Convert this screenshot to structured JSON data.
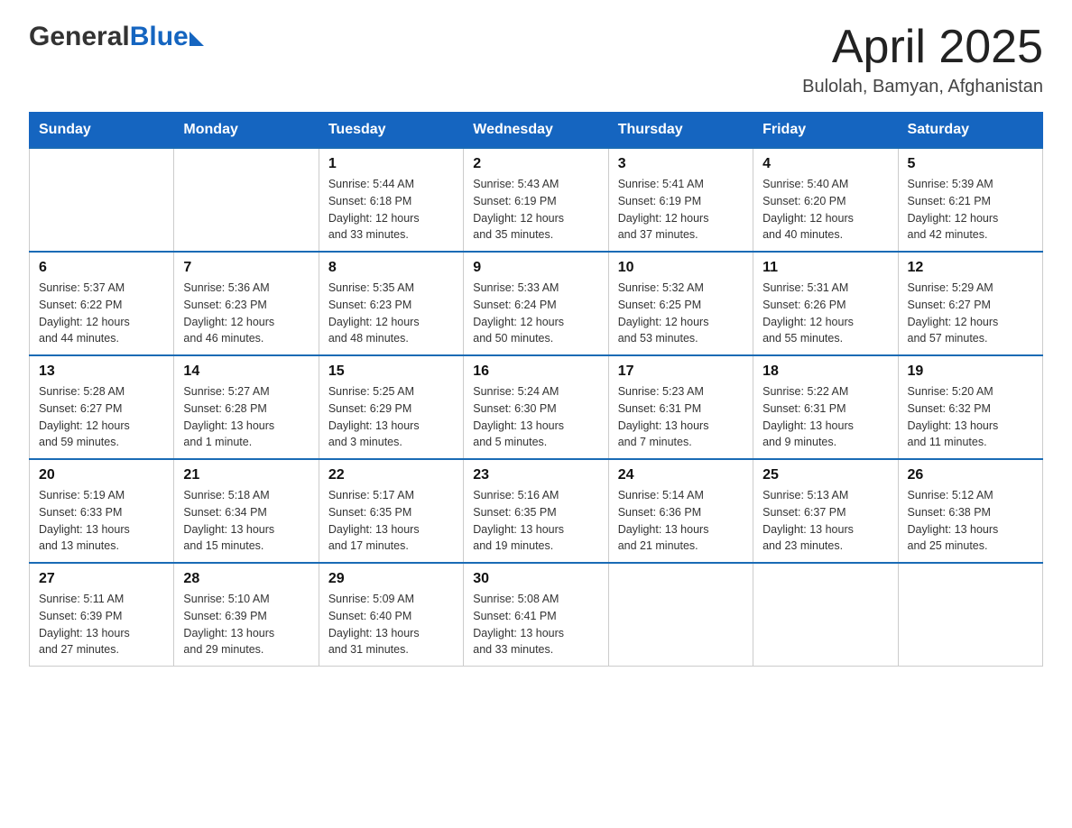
{
  "header": {
    "logo_general": "General",
    "logo_blue": "Blue",
    "title": "April 2025",
    "subtitle": "Bulolah, Bamyan, Afghanistan"
  },
  "columns": [
    "Sunday",
    "Monday",
    "Tuesday",
    "Wednesday",
    "Thursday",
    "Friday",
    "Saturday"
  ],
  "weeks": [
    [
      {
        "day": "",
        "info": ""
      },
      {
        "day": "",
        "info": ""
      },
      {
        "day": "1",
        "info": "Sunrise: 5:44 AM\nSunset: 6:18 PM\nDaylight: 12 hours\nand 33 minutes."
      },
      {
        "day": "2",
        "info": "Sunrise: 5:43 AM\nSunset: 6:19 PM\nDaylight: 12 hours\nand 35 minutes."
      },
      {
        "day": "3",
        "info": "Sunrise: 5:41 AM\nSunset: 6:19 PM\nDaylight: 12 hours\nand 37 minutes."
      },
      {
        "day": "4",
        "info": "Sunrise: 5:40 AM\nSunset: 6:20 PM\nDaylight: 12 hours\nand 40 minutes."
      },
      {
        "day": "5",
        "info": "Sunrise: 5:39 AM\nSunset: 6:21 PM\nDaylight: 12 hours\nand 42 minutes."
      }
    ],
    [
      {
        "day": "6",
        "info": "Sunrise: 5:37 AM\nSunset: 6:22 PM\nDaylight: 12 hours\nand 44 minutes."
      },
      {
        "day": "7",
        "info": "Sunrise: 5:36 AM\nSunset: 6:23 PM\nDaylight: 12 hours\nand 46 minutes."
      },
      {
        "day": "8",
        "info": "Sunrise: 5:35 AM\nSunset: 6:23 PM\nDaylight: 12 hours\nand 48 minutes."
      },
      {
        "day": "9",
        "info": "Sunrise: 5:33 AM\nSunset: 6:24 PM\nDaylight: 12 hours\nand 50 minutes."
      },
      {
        "day": "10",
        "info": "Sunrise: 5:32 AM\nSunset: 6:25 PM\nDaylight: 12 hours\nand 53 minutes."
      },
      {
        "day": "11",
        "info": "Sunrise: 5:31 AM\nSunset: 6:26 PM\nDaylight: 12 hours\nand 55 minutes."
      },
      {
        "day": "12",
        "info": "Sunrise: 5:29 AM\nSunset: 6:27 PM\nDaylight: 12 hours\nand 57 minutes."
      }
    ],
    [
      {
        "day": "13",
        "info": "Sunrise: 5:28 AM\nSunset: 6:27 PM\nDaylight: 12 hours\nand 59 minutes."
      },
      {
        "day": "14",
        "info": "Sunrise: 5:27 AM\nSunset: 6:28 PM\nDaylight: 13 hours\nand 1 minute."
      },
      {
        "day": "15",
        "info": "Sunrise: 5:25 AM\nSunset: 6:29 PM\nDaylight: 13 hours\nand 3 minutes."
      },
      {
        "day": "16",
        "info": "Sunrise: 5:24 AM\nSunset: 6:30 PM\nDaylight: 13 hours\nand 5 minutes."
      },
      {
        "day": "17",
        "info": "Sunrise: 5:23 AM\nSunset: 6:31 PM\nDaylight: 13 hours\nand 7 minutes."
      },
      {
        "day": "18",
        "info": "Sunrise: 5:22 AM\nSunset: 6:31 PM\nDaylight: 13 hours\nand 9 minutes."
      },
      {
        "day": "19",
        "info": "Sunrise: 5:20 AM\nSunset: 6:32 PM\nDaylight: 13 hours\nand 11 minutes."
      }
    ],
    [
      {
        "day": "20",
        "info": "Sunrise: 5:19 AM\nSunset: 6:33 PM\nDaylight: 13 hours\nand 13 minutes."
      },
      {
        "day": "21",
        "info": "Sunrise: 5:18 AM\nSunset: 6:34 PM\nDaylight: 13 hours\nand 15 minutes."
      },
      {
        "day": "22",
        "info": "Sunrise: 5:17 AM\nSunset: 6:35 PM\nDaylight: 13 hours\nand 17 minutes."
      },
      {
        "day": "23",
        "info": "Sunrise: 5:16 AM\nSunset: 6:35 PM\nDaylight: 13 hours\nand 19 minutes."
      },
      {
        "day": "24",
        "info": "Sunrise: 5:14 AM\nSunset: 6:36 PM\nDaylight: 13 hours\nand 21 minutes."
      },
      {
        "day": "25",
        "info": "Sunrise: 5:13 AM\nSunset: 6:37 PM\nDaylight: 13 hours\nand 23 minutes."
      },
      {
        "day": "26",
        "info": "Sunrise: 5:12 AM\nSunset: 6:38 PM\nDaylight: 13 hours\nand 25 minutes."
      }
    ],
    [
      {
        "day": "27",
        "info": "Sunrise: 5:11 AM\nSunset: 6:39 PM\nDaylight: 13 hours\nand 27 minutes."
      },
      {
        "day": "28",
        "info": "Sunrise: 5:10 AM\nSunset: 6:39 PM\nDaylight: 13 hours\nand 29 minutes."
      },
      {
        "day": "29",
        "info": "Sunrise: 5:09 AM\nSunset: 6:40 PM\nDaylight: 13 hours\nand 31 minutes."
      },
      {
        "day": "30",
        "info": "Sunrise: 5:08 AM\nSunset: 6:41 PM\nDaylight: 13 hours\nand 33 minutes."
      },
      {
        "day": "",
        "info": ""
      },
      {
        "day": "",
        "info": ""
      },
      {
        "day": "",
        "info": ""
      }
    ]
  ]
}
